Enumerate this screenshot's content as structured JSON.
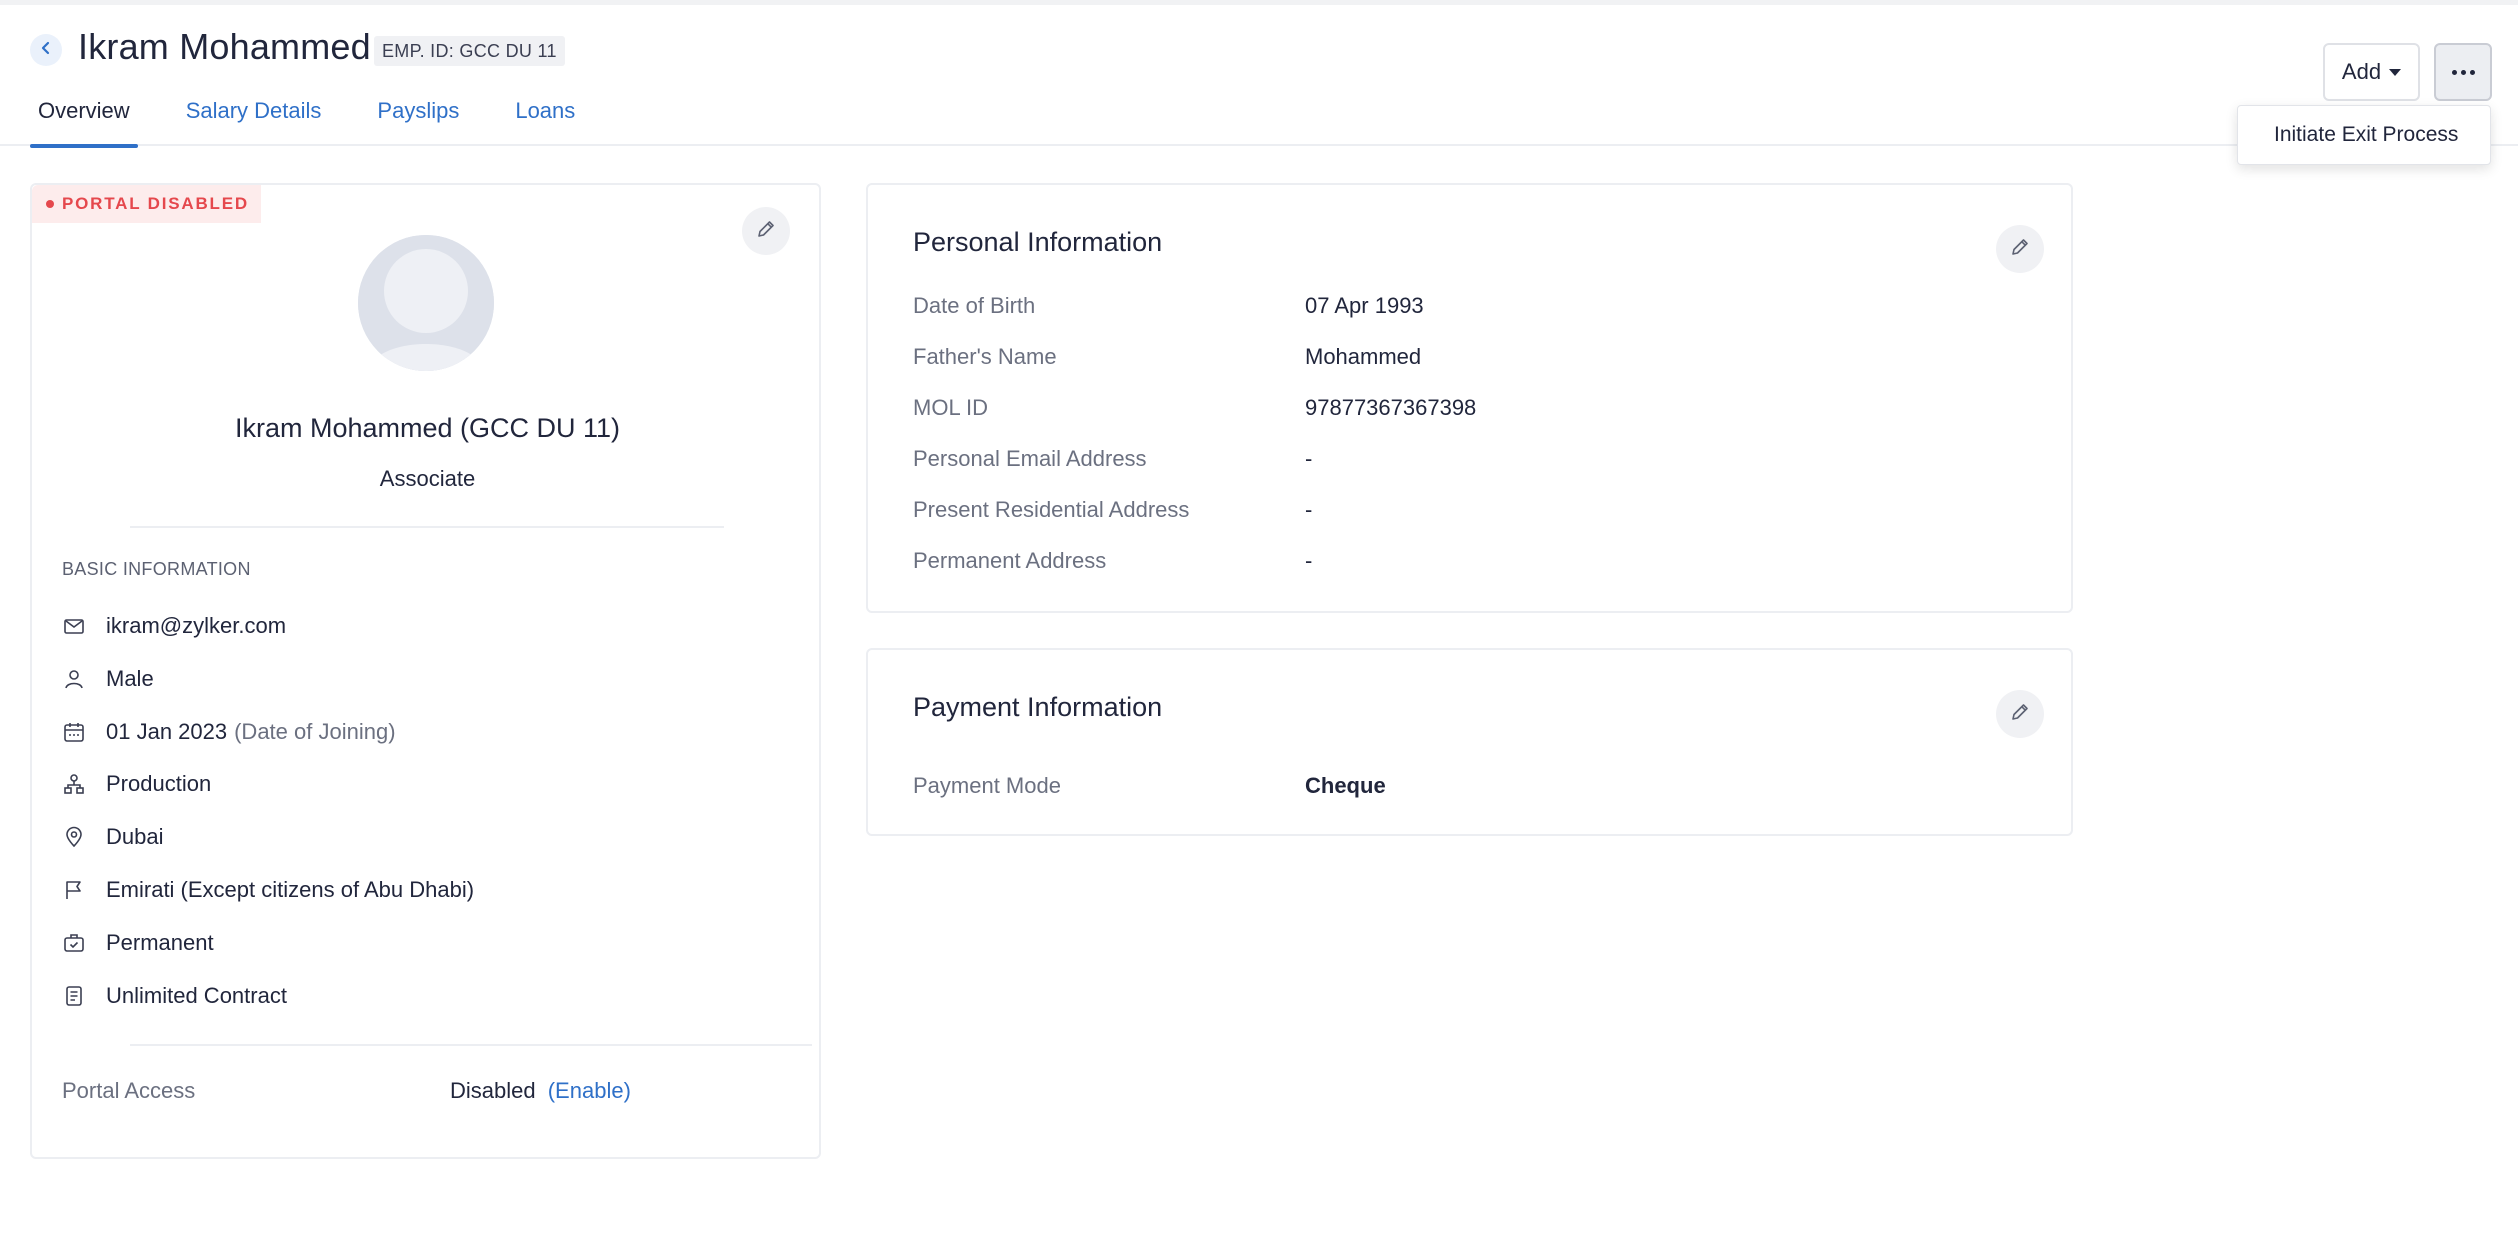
{
  "header": {
    "employee_name": "Ikram Mohammed",
    "employee_id_badge": "EMP. ID: GCC DU 11",
    "add_label": "Add",
    "more_menu_item": "Initiate Exit Process"
  },
  "tabs": [
    {
      "label": "Overview",
      "active": true
    },
    {
      "label": "Salary Details",
      "active": false
    },
    {
      "label": "Payslips",
      "active": false
    },
    {
      "label": "Loans",
      "active": false
    }
  ],
  "profile": {
    "portal_badge": "PORTAL DISABLED",
    "full_name": "Ikram Mohammed (GCC DU 11)",
    "designation": "Associate",
    "section_title": "BASIC INFORMATION",
    "email": "ikram@zylker.com",
    "gender": "Male",
    "joining_date": "01 Jan 2023",
    "joining_date_note": "(Date of Joining)",
    "department": "Production",
    "location": "Dubai",
    "nationality": "Emirati (Except citizens of Abu Dhabi)",
    "employment_type": "Permanent",
    "contract_type": "Unlimited Contract",
    "portal_access_label": "Portal Access",
    "portal_access_value": "Disabled",
    "portal_access_action": "(Enable)"
  },
  "personal_info": {
    "title": "Personal Information",
    "fields": [
      {
        "label": "Date of Birth",
        "value": "07 Apr 1993"
      },
      {
        "label": "Father's Name",
        "value": "Mohammed"
      },
      {
        "label": "MOL ID",
        "value": "97877367367398"
      },
      {
        "label": "Personal Email Address",
        "value": "-"
      },
      {
        "label": "Present Residential Address",
        "value": "-"
      },
      {
        "label": "Permanent Address",
        "value": "-"
      }
    ]
  },
  "payment_info": {
    "title": "Payment Information",
    "fields": [
      {
        "label": "Payment Mode",
        "value": "Cheque"
      }
    ]
  },
  "colors": {
    "accent": "#2f70c8",
    "danger": "#e5484d",
    "text": "#21263c",
    "muted_text": "#6b7080"
  },
  "icons": [
    "chevron-left-icon",
    "pencil-icon",
    "mail-icon",
    "person-icon",
    "calendar-icon",
    "org-chart-icon",
    "location-pin-icon",
    "flag-icon",
    "briefcase-icon",
    "document-icon",
    "more-icon",
    "caret-down-icon"
  ]
}
